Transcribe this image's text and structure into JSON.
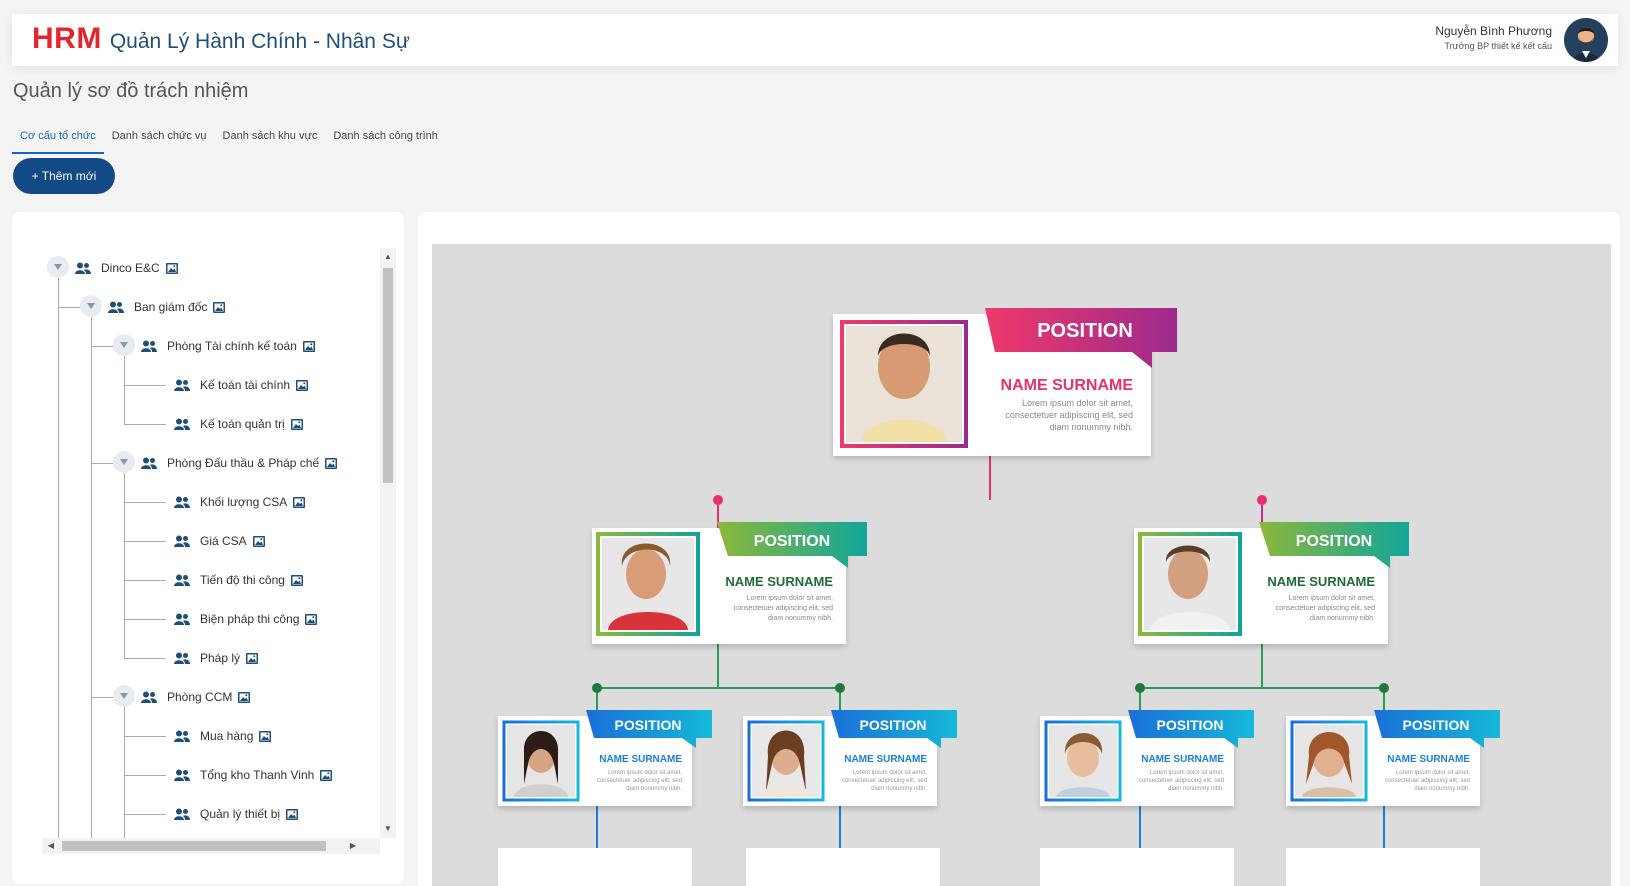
{
  "header": {
    "brand": "HRM",
    "app_title": "Quản Lý Hành Chính - Nhân Sự",
    "user_name": "Nguyễn Bình Phương",
    "user_role": "Trưởng BP thiết kế kết cấu"
  },
  "page": {
    "title": "Quản lý sơ đồ trách nhiệm",
    "add_button": "+ Thêm mới"
  },
  "tabs": [
    {
      "label": "Cơ cấu tổ chức",
      "active": true
    },
    {
      "label": "Danh sách chức vụ",
      "active": false
    },
    {
      "label": "Danh sách khu vực",
      "active": false
    },
    {
      "label": "Danh sách công trình",
      "active": false
    }
  ],
  "tree": [
    {
      "label": "Dinco E&C",
      "depth": 0,
      "expanded": true
    },
    {
      "label": "Ban giám đốc",
      "depth": 1,
      "expanded": true
    },
    {
      "label": "Phòng Tài chính kế toán",
      "depth": 2,
      "expanded": true
    },
    {
      "label": "Kế toán tài chính",
      "depth": 3
    },
    {
      "label": "Kế toán quản trị",
      "depth": 3
    },
    {
      "label": "Phòng Đấu thầu & Pháp chế",
      "depth": 2,
      "expanded": true
    },
    {
      "label": "Khối lượng CSA",
      "depth": 3
    },
    {
      "label": "Giá CSA",
      "depth": 3
    },
    {
      "label": "Tiến độ thi công",
      "depth": 3
    },
    {
      "label": "Biện pháp thi công",
      "depth": 3
    },
    {
      "label": "Pháp lý",
      "depth": 3
    },
    {
      "label": "Phòng CCM",
      "depth": 2,
      "expanded": true
    },
    {
      "label": "Mua hàng",
      "depth": 3
    },
    {
      "label": "Tổng kho Thanh Vinh",
      "depth": 3
    },
    {
      "label": "Quản lý thiết bị",
      "depth": 3
    }
  ],
  "org_chart": {
    "position_label": "POSITION",
    "name_label": "NAME SURNAME",
    "description": "Lorem ipsum dolor sit amet, consectetuer adipiscing elit, sed diam nonummy nibh.",
    "colors": {
      "top": "#e6306f",
      "middle": "#2e9c56",
      "bottom": "#1b7fd6",
      "background": "#dcdcdc"
    }
  },
  "icons": [
    "people-icon",
    "image-icon",
    "caret-down-icon",
    "avatar"
  ]
}
